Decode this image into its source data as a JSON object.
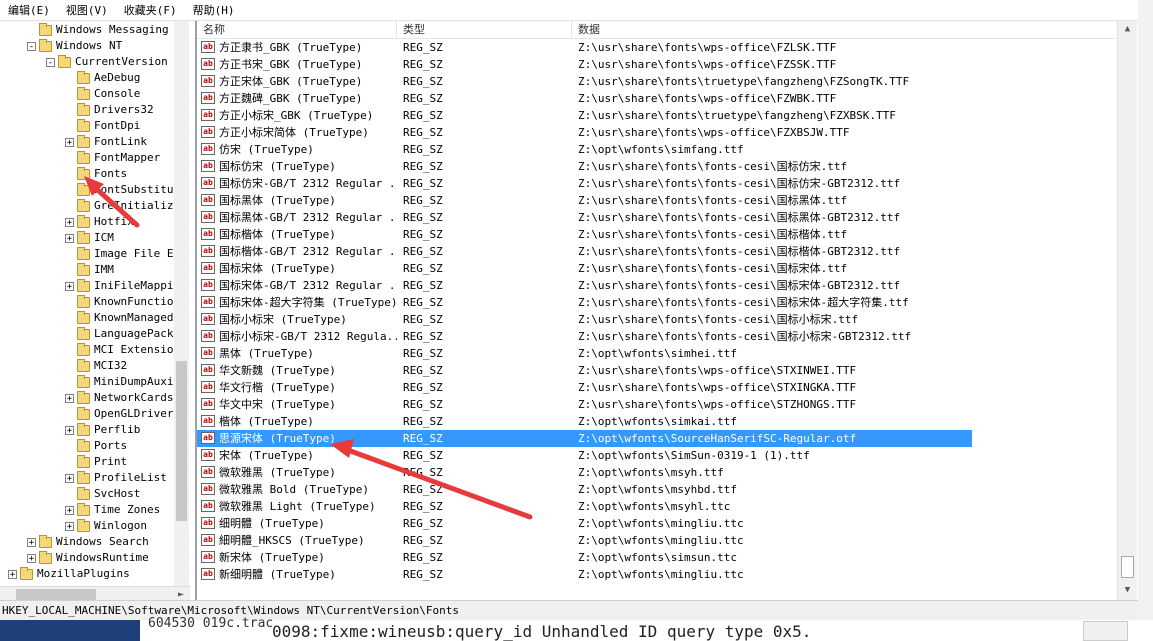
{
  "menubar": {
    "items": [
      "编辑(E)",
      "视图(V)",
      "收藏夹(F)",
      "帮助(H)"
    ]
  },
  "tree": {
    "items": [
      {
        "label": "Windows Messaging S",
        "depth": 1,
        "expander": "",
        "open": false
      },
      {
        "label": "Windows NT",
        "depth": 1,
        "expander": "-",
        "open": true
      },
      {
        "label": "CurrentVersion",
        "depth": 2,
        "expander": "-",
        "open": true
      },
      {
        "label": "AeDebug",
        "depth": 3,
        "expander": "",
        "open": false
      },
      {
        "label": "Console",
        "depth": 3,
        "expander": "",
        "open": false
      },
      {
        "label": "Drivers32",
        "depth": 3,
        "expander": "",
        "open": false
      },
      {
        "label": "FontDpi",
        "depth": 3,
        "expander": "",
        "open": false
      },
      {
        "label": "FontLink",
        "depth": 3,
        "expander": "+",
        "open": false
      },
      {
        "label": "FontMapper",
        "depth": 3,
        "expander": "",
        "open": false
      },
      {
        "label": "Fonts",
        "depth": 3,
        "expander": "",
        "open": true
      },
      {
        "label": "FontSubstitut",
        "depth": 3,
        "expander": "",
        "open": false
      },
      {
        "label": "GreInitializ",
        "depth": 3,
        "expander": "",
        "open": false
      },
      {
        "label": "Hotfix",
        "depth": 3,
        "expander": "+",
        "open": false
      },
      {
        "label": "ICM",
        "depth": 3,
        "expander": "+",
        "open": false
      },
      {
        "label": "Image File Ex",
        "depth": 3,
        "expander": "",
        "open": false
      },
      {
        "label": "IMM",
        "depth": 3,
        "expander": "",
        "open": false
      },
      {
        "label": "IniFileMappin",
        "depth": 3,
        "expander": "+",
        "open": false
      },
      {
        "label": "KnownFunction",
        "depth": 3,
        "expander": "",
        "open": false
      },
      {
        "label": "KnownManagedD",
        "depth": 3,
        "expander": "",
        "open": false
      },
      {
        "label": "LanguagePack",
        "depth": 3,
        "expander": "",
        "open": false
      },
      {
        "label": "MCI Extension",
        "depth": 3,
        "expander": "",
        "open": false
      },
      {
        "label": "MCI32",
        "depth": 3,
        "expander": "",
        "open": false
      },
      {
        "label": "MiniDumpAuxil",
        "depth": 3,
        "expander": "",
        "open": false
      },
      {
        "label": "NetworkCards",
        "depth": 3,
        "expander": "+",
        "open": false
      },
      {
        "label": "OpenGLDrivers",
        "depth": 3,
        "expander": "",
        "open": false
      },
      {
        "label": "Perflib",
        "depth": 3,
        "expander": "+",
        "open": false
      },
      {
        "label": "Ports",
        "depth": 3,
        "expander": "",
        "open": false
      },
      {
        "label": "Print",
        "depth": 3,
        "expander": "",
        "open": false
      },
      {
        "label": "ProfileList",
        "depth": 3,
        "expander": "+",
        "open": false
      },
      {
        "label": "SvcHost",
        "depth": 3,
        "expander": "",
        "open": false
      },
      {
        "label": "Time Zones",
        "depth": 3,
        "expander": "+",
        "open": false
      },
      {
        "label": "Winlogon",
        "depth": 3,
        "expander": "+",
        "open": false
      },
      {
        "label": "Windows Search",
        "depth": 1,
        "expander": "+",
        "open": false
      },
      {
        "label": "WindowsRuntime",
        "depth": 1,
        "expander": "+",
        "open": false
      },
      {
        "label": "MozillaPlugins",
        "depth": 0,
        "expander": "+",
        "open": false
      }
    ]
  },
  "list": {
    "columns": [
      "名称",
      "类型",
      "数据"
    ],
    "rows": [
      {
        "name": "方正隶书_GBK (TrueType)",
        "type": "REG_SZ",
        "data": "Z:\\usr\\share\\fonts\\wps-office\\FZLSK.TTF"
      },
      {
        "name": "方正书宋_GBK (TrueType)",
        "type": "REG_SZ",
        "data": "Z:\\usr\\share\\fonts\\wps-office\\FZSSK.TTF"
      },
      {
        "name": "方正宋体_GBK (TrueType)",
        "type": "REG_SZ",
        "data": "Z:\\usr\\share\\fonts\\truetype\\fangzheng\\FZSongTK.TTF"
      },
      {
        "name": "方正魏碑_GBK (TrueType)",
        "type": "REG_SZ",
        "data": "Z:\\usr\\share\\fonts\\wps-office\\FZWBK.TTF"
      },
      {
        "name": "方正小标宋_GBK (TrueType)",
        "type": "REG_SZ",
        "data": "Z:\\usr\\share\\fonts\\truetype\\fangzheng\\FZXBSK.TTF"
      },
      {
        "name": "方正小标宋简体 (TrueType)",
        "type": "REG_SZ",
        "data": "Z:\\usr\\share\\fonts\\wps-office\\FZXBSJW.TTF"
      },
      {
        "name": "仿宋 (TrueType)",
        "type": "REG_SZ",
        "data": "Z:\\opt\\wfonts\\simfang.ttf"
      },
      {
        "name": "国标仿宋 (TrueType)",
        "type": "REG_SZ",
        "data": "Z:\\usr\\share\\fonts\\fonts-cesi\\国标仿宋.ttf"
      },
      {
        "name": "国标仿宋-GB/T 2312 Regular ...",
        "type": "REG_SZ",
        "data": "Z:\\usr\\share\\fonts\\fonts-cesi\\国标仿宋-GBT2312.ttf"
      },
      {
        "name": "国标黑体 (TrueType)",
        "type": "REG_SZ",
        "data": "Z:\\usr\\share\\fonts\\fonts-cesi\\国标黑体.ttf"
      },
      {
        "name": "国标黑体-GB/T 2312 Regular ...",
        "type": "REG_SZ",
        "data": "Z:\\usr\\share\\fonts\\fonts-cesi\\国标黑体-GBT2312.ttf"
      },
      {
        "name": "国标楷体 (TrueType)",
        "type": "REG_SZ",
        "data": "Z:\\usr\\share\\fonts\\fonts-cesi\\国标楷体.ttf"
      },
      {
        "name": "国标楷体-GB/T 2312 Regular ...",
        "type": "REG_SZ",
        "data": "Z:\\usr\\share\\fonts\\fonts-cesi\\国标楷体-GBT2312.ttf"
      },
      {
        "name": "国标宋体 (TrueType)",
        "type": "REG_SZ",
        "data": "Z:\\usr\\share\\fonts\\fonts-cesi\\国标宋体.ttf"
      },
      {
        "name": "国标宋体-GB/T 2312 Regular ...",
        "type": "REG_SZ",
        "data": "Z:\\usr\\share\\fonts\\fonts-cesi\\国标宋体-GBT2312.ttf"
      },
      {
        "name": "国标宋体-超大字符集 (TrueType)",
        "type": "REG_SZ",
        "data": "Z:\\usr\\share\\fonts\\fonts-cesi\\国标宋体-超大字符集.ttf"
      },
      {
        "name": "国标小标宋 (TrueType)",
        "type": "REG_SZ",
        "data": "Z:\\usr\\share\\fonts\\fonts-cesi\\国标小标宋.ttf"
      },
      {
        "name": "国标小标宋-GB/T 2312 Regula...",
        "type": "REG_SZ",
        "data": "Z:\\usr\\share\\fonts\\fonts-cesi\\国标小标宋-GBT2312.ttf"
      },
      {
        "name": "黑体 (TrueType)",
        "type": "REG_SZ",
        "data": "Z:\\opt\\wfonts\\simhei.ttf"
      },
      {
        "name": "华文新魏 (TrueType)",
        "type": "REG_SZ",
        "data": "Z:\\usr\\share\\fonts\\wps-office\\STXINWEI.TTF"
      },
      {
        "name": "华文行楷 (TrueType)",
        "type": "REG_SZ",
        "data": "Z:\\usr\\share\\fonts\\wps-office\\STXINGKA.TTF"
      },
      {
        "name": "华文中宋 (TrueType)",
        "type": "REG_SZ",
        "data": "Z:\\usr\\share\\fonts\\wps-office\\STZHONGS.TTF"
      },
      {
        "name": "楷体 (TrueType)",
        "type": "REG_SZ",
        "data": "Z:\\opt\\wfonts\\simkai.ttf"
      },
      {
        "name": "思源宋体 (TrueType)",
        "type": "REG_SZ",
        "data": "Z:\\opt\\wfonts\\SourceHanSerifSC-Regular.otf",
        "selected": true
      },
      {
        "name": "宋体 (TrueType)",
        "type": "REG_SZ",
        "data": "Z:\\opt\\wfonts\\SimSun-0319-1 (1).ttf"
      },
      {
        "name": "微软雅黑 (TrueType)",
        "type": "REG_SZ",
        "data": "Z:\\opt\\wfonts\\msyh.ttf"
      },
      {
        "name": "微软雅黑 Bold (TrueType)",
        "type": "REG_SZ",
        "data": "Z:\\opt\\wfonts\\msyhbd.ttf"
      },
      {
        "name": "微软雅黑 Light (TrueType)",
        "type": "REG_SZ",
        "data": "Z:\\opt\\wfonts\\msyhl.ttc"
      },
      {
        "name": "细明體 (TrueType)",
        "type": "REG_SZ",
        "data": "Z:\\opt\\wfonts\\mingliu.ttc"
      },
      {
        "name": "細明體_HKSCS (TrueType)",
        "type": "REG_SZ",
        "data": "Z:\\opt\\wfonts\\mingliu.ttc"
      },
      {
        "name": "新宋体 (TrueType)",
        "type": "REG_SZ",
        "data": "Z:\\opt\\wfonts\\simsun.ttc"
      },
      {
        "name": "新细明體 (TrueType)",
        "type": "REG_SZ",
        "data": "Z:\\opt\\wfonts\\mingliu.ttc"
      }
    ]
  },
  "statusbar": {
    "path": "HKEY_LOCAL_MACHINE\\Software\\Microsoft\\Windows NT\\CurrentVersion\\Fonts"
  },
  "background": {
    "left_text": "604530 019c.trac",
    "console_text": "0098:fixme:wineusb:query_id Unhandled ID query type 0x5."
  },
  "colors": {
    "selection": "#3399ff",
    "annotation_arrow": "#e83a3a",
    "folder": "#f5d77a"
  },
  "icons": {
    "tree_node": "folder-icon",
    "value_row": "string-value-icon",
    "annotation": "red-arrow-icon"
  }
}
